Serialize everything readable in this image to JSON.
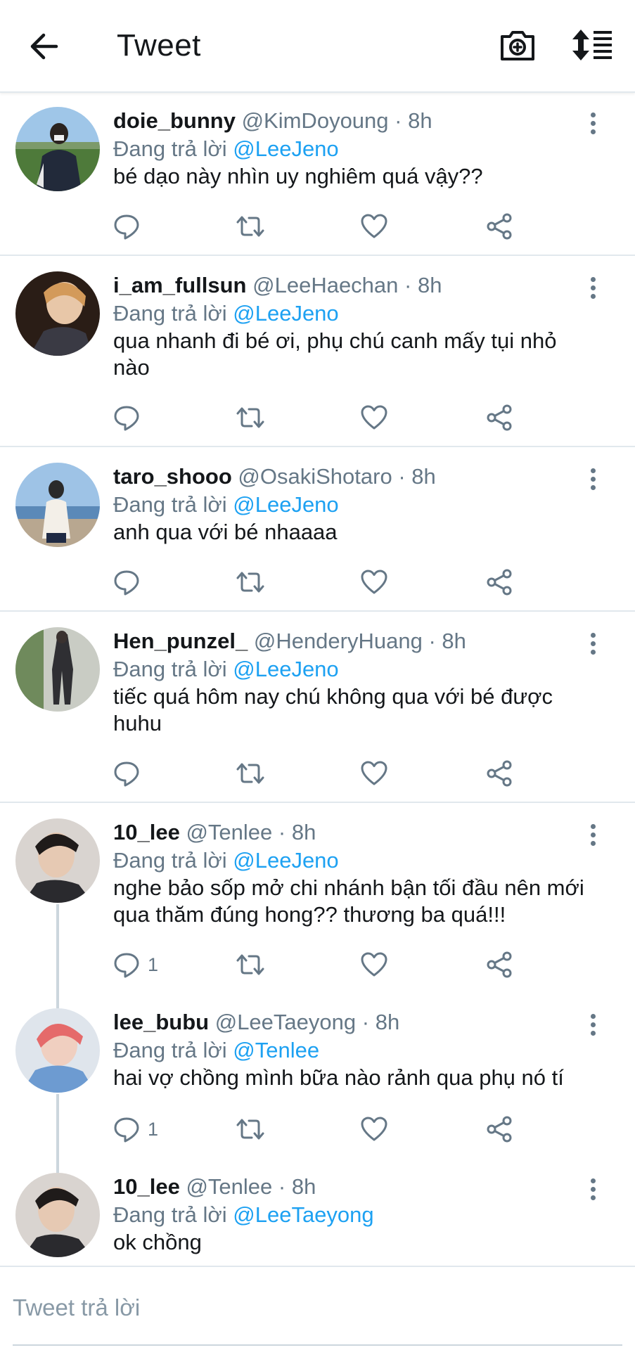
{
  "header": {
    "title": "Tweet",
    "icons": [
      "arrow-left-icon",
      "camera-plus-icon",
      "sort-icon"
    ]
  },
  "colors": {
    "accent": "#1da1f2",
    "secondary_text": "#657786",
    "divider": "#e1e8ed"
  },
  "tweets": [
    {
      "name": "doie_bunny",
      "handle": "@KimDoyoung",
      "sep": "·",
      "time": "8h",
      "replying_prefix": "Đang trả lời",
      "replying_to": "@LeeJeno",
      "text": "bé dạo này nhìn uy nghiêm quá vậy??",
      "reply_count": ""
    },
    {
      "name": "i_am_fullsun",
      "handle": "@LeeHaechan",
      "sep": "·",
      "time": "8h",
      "replying_prefix": "Đang trả lời",
      "replying_to": "@LeeJeno",
      "text": "qua nhanh đi bé ơi, phụ chú canh mấy tụi nhỏ nào",
      "reply_count": ""
    },
    {
      "name": "taro_shooo",
      "handle": "@OsakiShotaro",
      "sep": "·",
      "time": "8h",
      "replying_prefix": "Đang trả lời",
      "replying_to": "@LeeJeno",
      "text": "anh qua với bé nhaaaa",
      "reply_count": ""
    },
    {
      "name": "Hen_punzel_",
      "handle": "@HenderyHuang",
      "sep": "·",
      "time": "8h",
      "replying_prefix": "Đang trả lời",
      "replying_to": "@LeeJeno",
      "text": "tiếc quá hôm nay chú không qua với bé được huhu",
      "reply_count": ""
    },
    {
      "name": "10_lee",
      "handle": "@Tenlee",
      "sep": "·",
      "time": "8h",
      "replying_prefix": "Đang trả lời",
      "replying_to": "@LeeJeno",
      "text": "nghe bảo sốp mở chi nhánh bận tối đầu nên mới qua thăm đúng hong?? thương ba quá!!!",
      "reply_count": "1"
    },
    {
      "name": "lee_bubu",
      "handle": "@LeeTaeyong",
      "sep": "·",
      "time": "8h",
      "replying_prefix": "Đang trả lời",
      "replying_to": "@Tenlee",
      "text": "hai vợ chồng mình bữa nào rảnh qua phụ nó tí",
      "reply_count": "1"
    },
    {
      "name": "10_lee",
      "handle": "@Tenlee",
      "sep": "·",
      "time": "8h",
      "replying_prefix": "Đang trả lời",
      "replying_to": "@LeeTaeyong",
      "text": "ok chồng",
      "reply_count": ""
    }
  ],
  "action_icons": [
    "reply-icon",
    "retweet-icon",
    "like-icon",
    "share-icon"
  ],
  "reply_box": {
    "placeholder": "Tweet trả lời"
  }
}
